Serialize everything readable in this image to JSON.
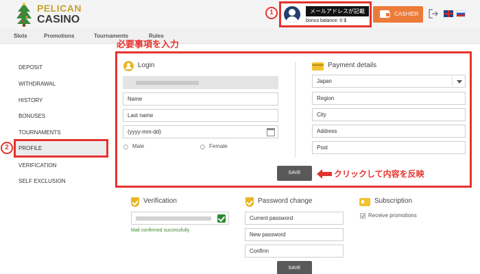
{
  "header": {
    "logo_line1": "PELICAN",
    "logo_line2": "CASINO",
    "marker_user": "1",
    "email_label": "メールアドレスが記載",
    "bonus_balance": "bonus balance:  0 $",
    "cashier_label": "CASHIER",
    "languages": [
      "en",
      "ru"
    ]
  },
  "nav": {
    "items": [
      "Slots",
      "Promotions",
      "Tournaments",
      "Rules"
    ]
  },
  "sidebar": {
    "marker_profile": "2",
    "items": [
      "DEPOSIT",
      "WITHDRAWAL",
      "HISTORY",
      "BONUSES",
      "TOURNAMENTS",
      "PROFILE",
      "VERIFICATION",
      "SELF EXCLUSION"
    ],
    "active": "PROFILE"
  },
  "annotations": {
    "top": "必要事項を入力",
    "save_hint": "クリックして内容を反映",
    "accent_color": "#e5322d"
  },
  "login": {
    "title": "Login",
    "name_placeholder": "Name",
    "lastname_placeholder": "Last name",
    "birthdate_placeholder": "(yyyy-mm-dd)",
    "gender_male": "Male",
    "gender_female": "Female"
  },
  "payment": {
    "title": "Payment details",
    "country": "Japan",
    "region_placeholder": "Region",
    "city_placeholder": "City",
    "address_placeholder": "Address",
    "post_placeholder": "Post"
  },
  "save_label": "SAVE",
  "verification": {
    "title": "Verification",
    "status": "Mail confirmed successfully"
  },
  "password": {
    "title": "Password change",
    "current_placeholder": "Current password",
    "new_placeholder": "New password",
    "confirm_placeholder": "Confirm",
    "save_label": "SAVE"
  },
  "subscription": {
    "title": "Subscription",
    "receive_label": "Receive promotions",
    "receive_checked": true
  }
}
